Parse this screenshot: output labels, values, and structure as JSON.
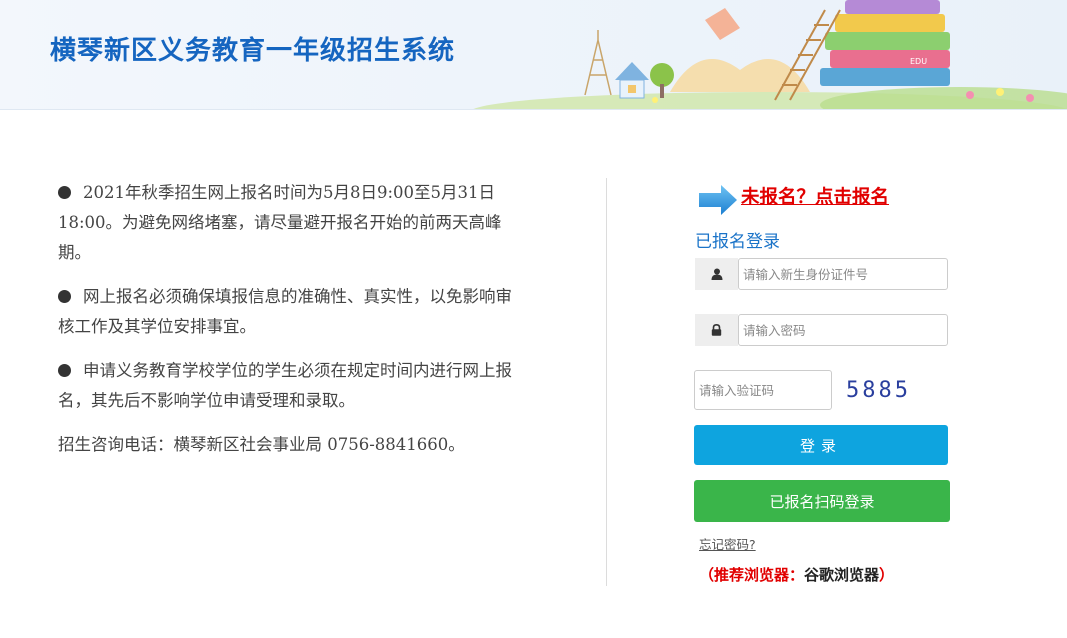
{
  "header": {
    "title": "横琴新区义务教育一年级招生系统",
    "art_label": "EDU"
  },
  "notices": [
    "2021年秋季招生网上报名时间为5月8日9:00至5月31日18:00。为避免网络堵塞，请尽量避开报名开始的前两天高峰期。",
    "网上报名必须确保填报信息的准确性、真实性，以免影响审核工作及其学位安排事宜。",
    "申请义务教育学校学位的学生必须在规定时间内进行网上报名，其先后不影响学位申请受理和录取。"
  ],
  "hotline": "招生咨询电话：横琴新区社会事业局 0756-8841660。",
  "login": {
    "register_link": "未报名？点击报名",
    "subtitle": "已报名登录",
    "id_placeholder": "请输入新生身份证件号",
    "password_placeholder": "请输入密码",
    "captcha_placeholder": "请输入验证码",
    "captcha_code": "5885",
    "login_button": "登录",
    "scan_button": "已报名扫码登录",
    "forgot": "忘记密码?",
    "browser_tip_open": "（",
    "browser_tip_label": "推荐浏览器：",
    "browser_tip_value": "谷歌浏览器",
    "browser_tip_close": "）"
  },
  "colors": {
    "title_blue": "#1565c0",
    "link_red": "#e10000",
    "login_blue": "#0ea4df",
    "scan_green": "#3ab54a",
    "subtitle_blue": "#1a73c8"
  },
  "icons": [
    "arrow-right-icon",
    "user-icon",
    "lock-icon"
  ]
}
